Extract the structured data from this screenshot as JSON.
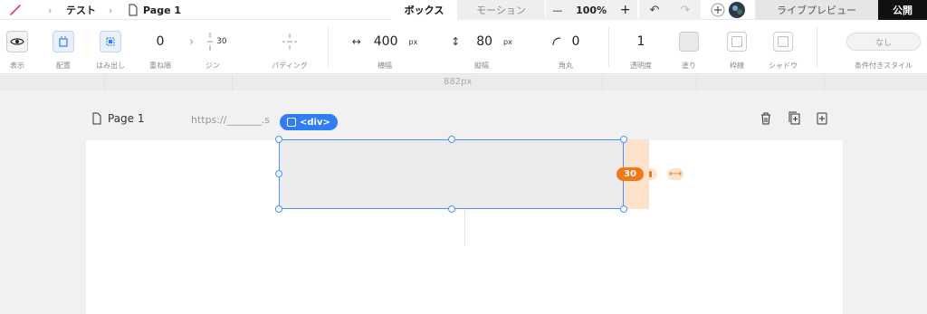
{
  "topbar": {
    "project": "テスト",
    "page": "Page 1",
    "tabs": [
      {
        "label": "ボックス",
        "active": true
      },
      {
        "label": "モーション",
        "active": false
      }
    ],
    "zoom": "100%",
    "zoom_out": "—",
    "zoom_in": "+",
    "preview_label": "ライブプレビュー",
    "publish_label": "公開"
  },
  "toolbar": {
    "display_label": "表示",
    "layout_label": "配置",
    "overflow_label": "はみ出し",
    "order_value": "0",
    "order_label": "重ね順",
    "margin_value": "30",
    "margin_label": "ジン",
    "padding_label": "パディング",
    "width_value": "400",
    "width_unit": "px",
    "width_label": "横幅",
    "height_value": "80",
    "height_unit": "px",
    "height_label": "縦幅",
    "radius_value": "0",
    "radius_label": "角丸",
    "opacity_value": "1",
    "opacity_label": "透明度",
    "fill_label": "塗り",
    "border_label": "枠線",
    "shadow_label": "シャドウ",
    "conditional_value": "なし",
    "conditional_label": "条件付きスタイル"
  },
  "ruler": {
    "width_label": "882px"
  },
  "canvas": {
    "page_title": "Page 1",
    "url": "https://_______.s",
    "selected_tag": "<div>",
    "margin_badge": "30",
    "brand_color": "#2f7ef5",
    "margin_color": "#f07a1a"
  }
}
